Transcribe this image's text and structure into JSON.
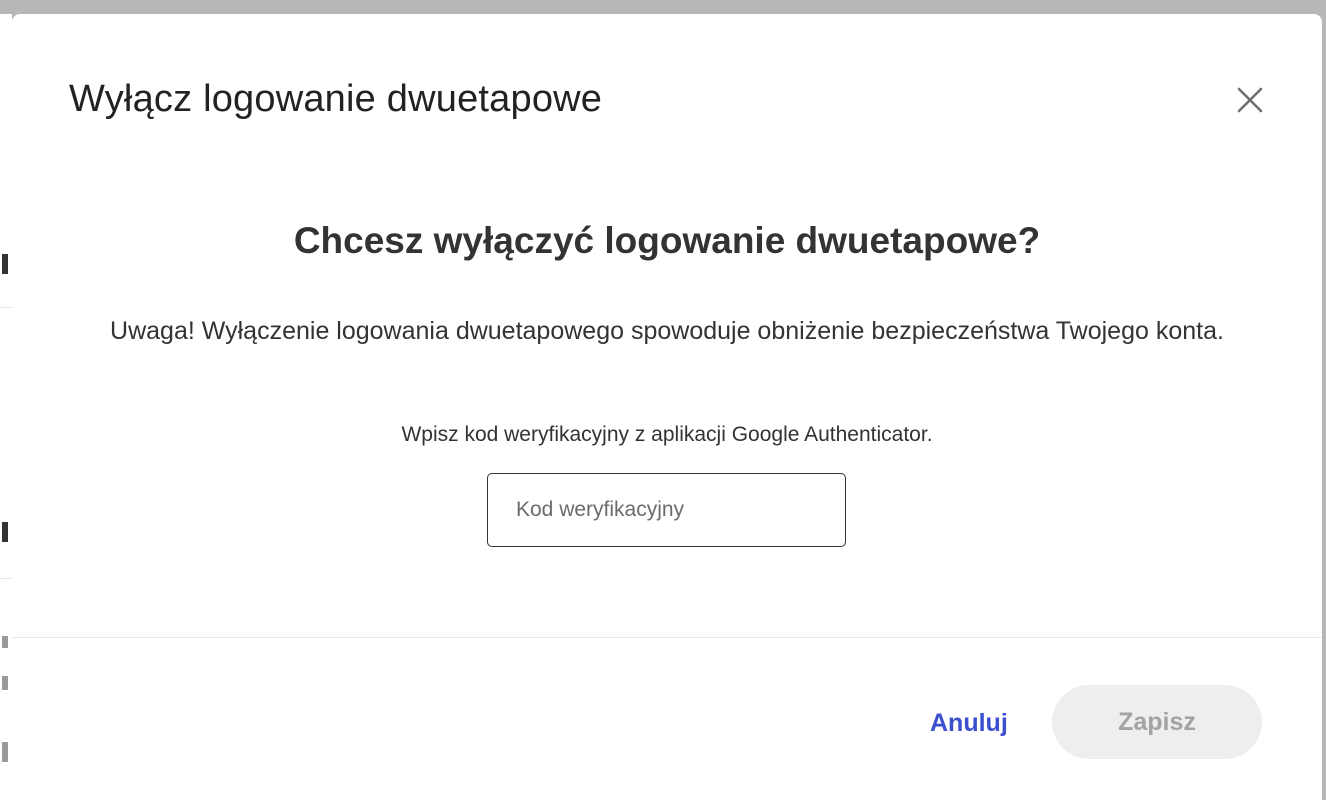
{
  "modal": {
    "title": "Wyłącz logowanie dwuetapowe",
    "heading": "Chcesz wyłączyć logowanie dwuetapowe?",
    "warning": "Uwaga! Wyłączenie logowania dwuetapowego spowoduje obniżenie bezpieczeństwa Twojego konta.",
    "instruction": "Wpisz kod weryfikacyjny z aplikacji Google Authenticator.",
    "code_input": {
      "placeholder": "Kod weryfikacyjny",
      "value": ""
    },
    "close_icon": "close-icon",
    "buttons": {
      "cancel_label": "Anuluj",
      "save_label": "Zapisz",
      "save_disabled": true
    }
  },
  "colors": {
    "primary_link": "#3b4fcf",
    "disabled_button_bg": "#eeeeee",
    "disabled_button_text": "#a3a3a3",
    "text": "#333333",
    "overlay": "#b7b7b7"
  }
}
